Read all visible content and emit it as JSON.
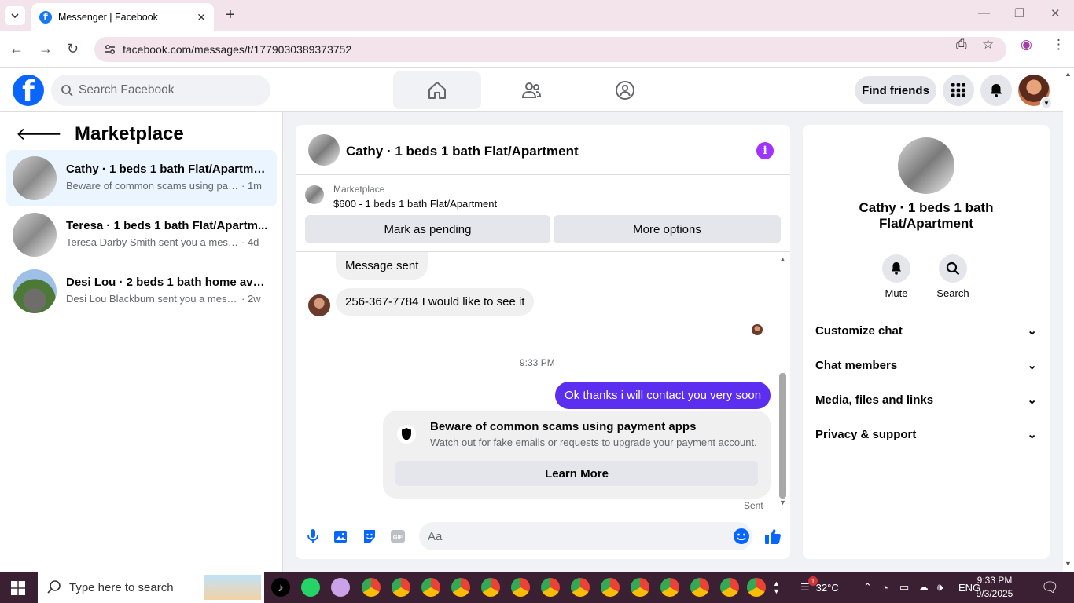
{
  "browser": {
    "tab_title": "Messenger | Facebook",
    "url": "facebook.com/messages/t/1779030389373752"
  },
  "fb_header": {
    "search_placeholder": "Search Facebook",
    "find_friends": "Find friends"
  },
  "left_pane": {
    "title": "Marketplace",
    "conversations": [
      {
        "name": "Cathy · 1 beds 1 bath Flat/Apartment",
        "preview": "Beware of common scams using pay...",
        "time": "· 1m"
      },
      {
        "name": "Teresa · 1 beds 1 bath Flat/Apartm...",
        "preview": "Teresa Darby Smith sent you a messa...",
        "time": "· 4d"
      },
      {
        "name": "Desi Lou · 2 beds 1 bath home avai...",
        "preview": "Desi Lou Blackburn sent you a messa...",
        "time": "· 2w"
      }
    ]
  },
  "chat": {
    "title": "Cathy · 1 beds 1 bath Flat/Apartment",
    "marketplace_label": "Marketplace",
    "listing": "$600 - 1 beds 1 bath Flat/Apartment",
    "mark_pending": "Mark as pending",
    "more_options": "More options",
    "messages": [
      {
        "text": "Message sent"
      },
      {
        "text": "256-367-7784 I would like to see it"
      }
    ],
    "timestamp": "9:33 PM",
    "outgoing": "Ok thanks i will contact you very soon",
    "scam_title": "Beware of common scams using payment apps",
    "scam_desc": "Watch out for fake emails or requests to upgrade your payment account.",
    "learn_more": "Learn More",
    "sent_label": "Sent",
    "composer_placeholder": "Aa"
  },
  "right_pane": {
    "name": "Cathy · 1 beds 1 bath Flat/Apartment",
    "mute": "Mute",
    "search": "Search",
    "sections": [
      "Customize chat",
      "Chat members",
      "Media, files and links",
      "Privacy & support"
    ]
  },
  "taskbar": {
    "search_placeholder": "Type here to search",
    "temperature": "32°C",
    "language": "ENG",
    "time": "9:33 PM",
    "date": "9/3/2025",
    "weather_badge": "1"
  },
  "colors": {
    "fb_blue": "#0866ff",
    "outgoing_bubble": "#5b2ef0",
    "info_purple": "#a033ff"
  }
}
